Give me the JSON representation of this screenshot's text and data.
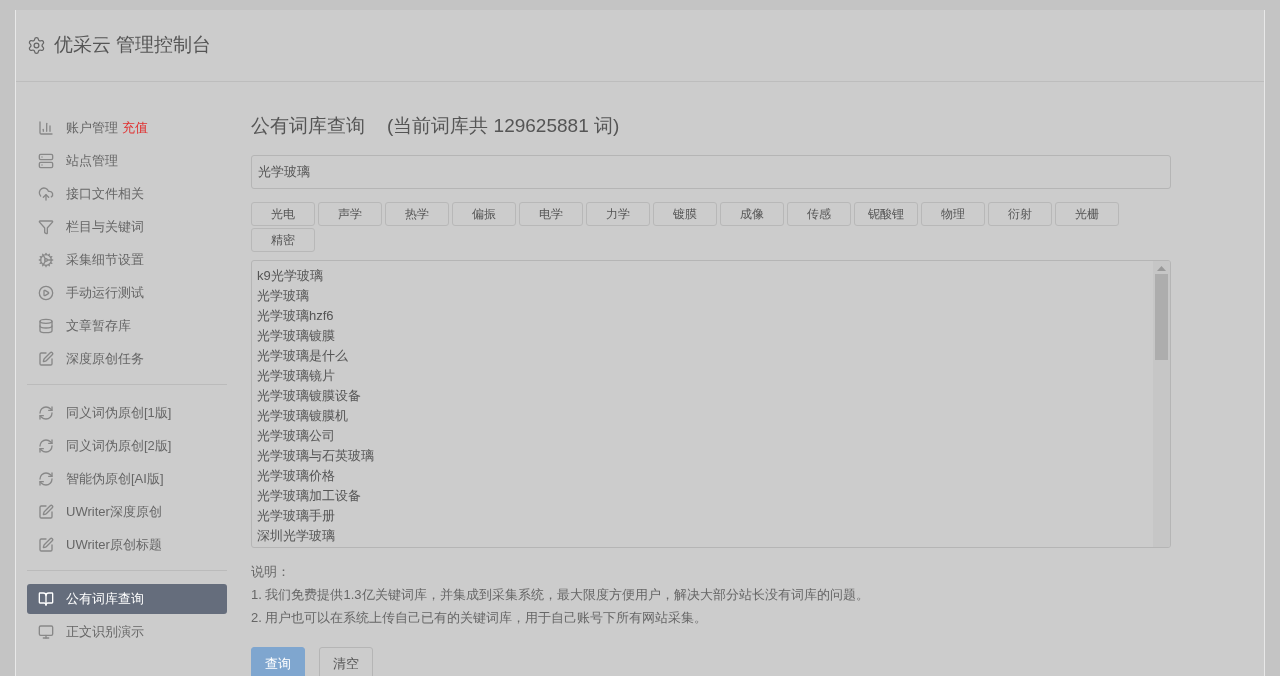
{
  "header": {
    "title": "优采云 管理控制台"
  },
  "sidebar": {
    "groups": [
      {
        "items": [
          {
            "label": "账户管理",
            "badge": "充值",
            "selected": false
          },
          {
            "label": "站点管理",
            "selected": false
          },
          {
            "label": "接口文件相关",
            "selected": false
          },
          {
            "label": "栏目与关键词",
            "selected": false
          },
          {
            "label": "采集细节设置",
            "selected": false
          },
          {
            "label": "手动运行测试",
            "selected": false
          },
          {
            "label": "文章暂存库",
            "selected": false
          },
          {
            "label": "深度原创任务",
            "selected": false
          }
        ]
      },
      {
        "items": [
          {
            "label": "同义词伪原创[1版]",
            "selected": false
          },
          {
            "label": "同义词伪原创[2版]",
            "selected": false
          },
          {
            "label": "智能伪原创[AI版]",
            "selected": false
          },
          {
            "label": "UWriter深度原创",
            "selected": false
          },
          {
            "label": "UWriter原创标题",
            "selected": false
          }
        ]
      },
      {
        "items": [
          {
            "label": "公有词库查询",
            "selected": true
          },
          {
            "label": "正文识别演示",
            "selected": false
          }
        ]
      }
    ]
  },
  "main": {
    "title": "公有词库查询",
    "count": "(当前词库共 129625881 词)",
    "search": {
      "value": "光学玻璃"
    },
    "tags": [
      "光电",
      "声学",
      "热学",
      "偏振",
      "电学",
      "力学",
      "镀膜",
      "成像",
      "传感",
      "铌酸锂",
      "物理",
      "衍射",
      "光栅",
      "精密"
    ],
    "results": [
      "k9光学玻璃",
      "光学玻璃",
      "光学玻璃hzf6",
      "光学玻璃镀膜",
      "光学玻璃是什么",
      "光学玻璃镜片",
      "光学玻璃镀膜设备",
      "光学玻璃镀膜机",
      "光学玻璃公司",
      "光学玻璃与石英玻璃",
      "光学玻璃价格",
      "光学玻璃加工设备",
      "光学玻璃手册",
      "深圳光学玻璃"
    ],
    "notes_title": "说明：",
    "notes": [
      "1. 我们免费提供1.3亿关键词库，并集成到采集系统，最大限度方便用户，解决大部分站长没有词库的问题。",
      "2. 用户也可以在系统上传自己已有的关键词库，用于自己账号下所有网站采集。"
    ],
    "buttons": [
      {
        "label": "查询",
        "kind": "primary"
      },
      {
        "label": "清空",
        "kind": "default"
      }
    ]
  }
}
